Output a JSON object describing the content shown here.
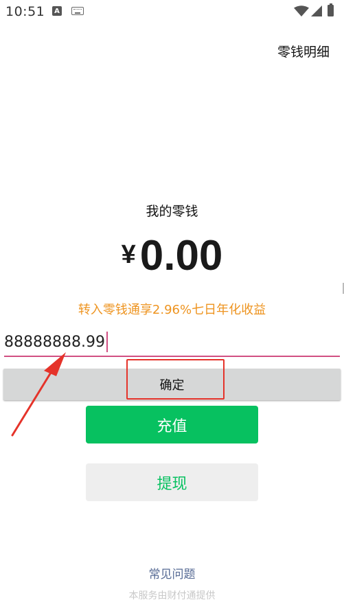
{
  "status_bar": {
    "time": "10:51",
    "icons": [
      "notification-a-icon",
      "keyboard-icon",
      "wifi-icon",
      "signal-icon",
      "battery-icon"
    ],
    "a_glyph": "A"
  },
  "header": {
    "detail_link": "零钱明细"
  },
  "balance": {
    "label": "我的零钱",
    "currency": "¥",
    "amount": "0.00"
  },
  "promo": {
    "text": "转入零钱通享2.96%七日年化收益"
  },
  "amount_input": {
    "value": "88888888.99"
  },
  "actions": {
    "confirm_label": "确定",
    "recharge_label": "充值",
    "withdraw_label": "提现"
  },
  "footer": {
    "faq_link": "常见问题",
    "provider_note": "本服务由财付通提供"
  },
  "colors": {
    "accent_green": "#07c160",
    "promo_orange": "#ee9420",
    "input_underline": "#d14f82",
    "annotation_red": "#e5332a",
    "link_blue": "#566a94"
  }
}
